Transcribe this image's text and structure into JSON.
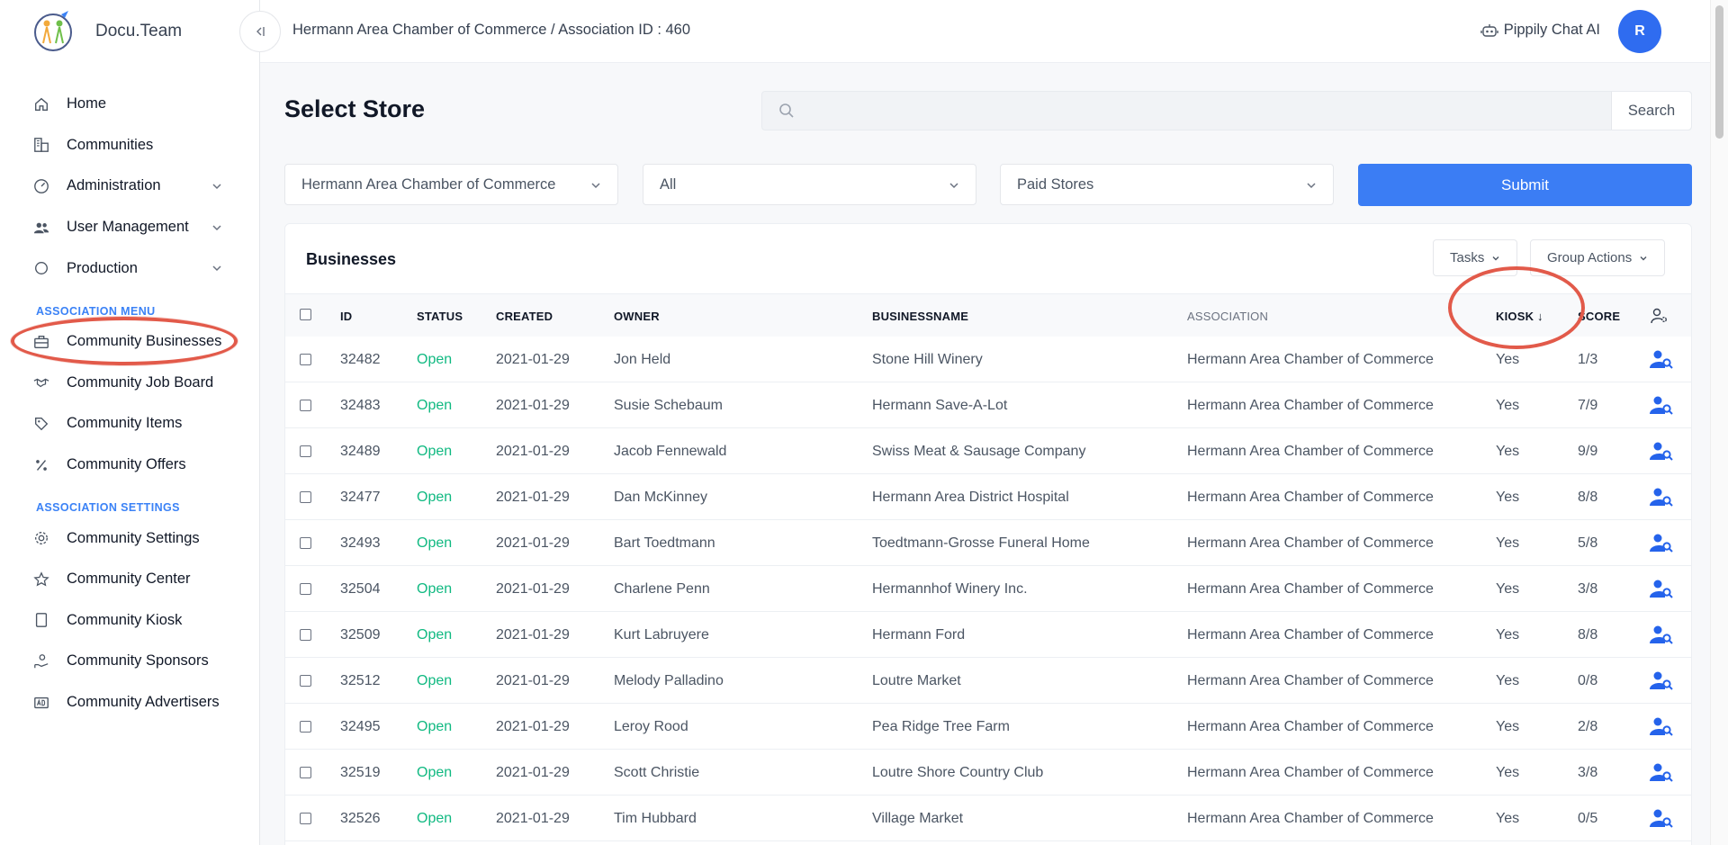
{
  "brand": {
    "name": "Docu.Team"
  },
  "sidebar": {
    "items": [
      {
        "label": "Home",
        "icon": "home-icon"
      },
      {
        "label": "Communities",
        "icon": "buildings-icon"
      },
      {
        "label": "Administration",
        "icon": "gauge-icon"
      },
      {
        "label": "User Management",
        "icon": "users-icon"
      },
      {
        "label": "Production",
        "icon": "circle-icon"
      }
    ],
    "section_association_menu": "ASSOCIATION MENU",
    "association_menu": [
      {
        "label": "Community Businesses",
        "icon": "briefcase-icon"
      },
      {
        "label": "Community Job Board",
        "icon": "handshake-icon"
      },
      {
        "label": "Community Items",
        "icon": "tag-icon"
      },
      {
        "label": "Community Offers",
        "icon": "percent-icon"
      }
    ],
    "section_association_settings": "ASSOCIATION SETTINGS",
    "association_settings": [
      {
        "label": "Community Settings",
        "icon": "gear-icon"
      },
      {
        "label": "Community Center",
        "icon": "star-icon"
      },
      {
        "label": "Community Kiosk",
        "icon": "tablet-icon"
      },
      {
        "label": "Community Sponsors",
        "icon": "hand-coin-icon"
      },
      {
        "label": "Community Advertisers",
        "icon": "ad-icon"
      }
    ]
  },
  "topbar": {
    "breadcrumb": "Hermann Area Chamber of Commerce / Association ID : 460",
    "chat_label": "Pippily Chat AI",
    "avatar_initial": "R"
  },
  "main": {
    "title": "Select Store",
    "search_placeholder": "",
    "search_button": "Search",
    "filters": {
      "association": "Hermann Area Chamber of Commerce",
      "category": "All",
      "store_type": "Paid Stores"
    },
    "submit_label": "Submit"
  },
  "businesses": {
    "title": "Businesses",
    "tasks_label": "Tasks",
    "group_actions_label": "Group Actions",
    "columns": {
      "id": "ID",
      "status": "STATUS",
      "created": "CREATED",
      "owner": "OWNER",
      "businessname": "BUSINESSNAME",
      "association": "ASSOCIATION",
      "kiosk": "KIOSK ↓",
      "score": "SCORE"
    },
    "rows": [
      {
        "id": "32482",
        "status": "Open",
        "created": "2021-01-29",
        "owner": "Jon Held",
        "business": "Stone Hill Winery",
        "association": "Hermann Area Chamber of Commerce",
        "kiosk": "Yes",
        "score": "1/3"
      },
      {
        "id": "32483",
        "status": "Open",
        "created": "2021-01-29",
        "owner": "Susie Schebaum",
        "business": "Hermann Save-A-Lot",
        "association": "Hermann Area Chamber of Commerce",
        "kiosk": "Yes",
        "score": "7/9"
      },
      {
        "id": "32489",
        "status": "Open",
        "created": "2021-01-29",
        "owner": "Jacob Fennewald",
        "business": "Swiss Meat & Sausage Company",
        "association": "Hermann Area Chamber of Commerce",
        "kiosk": "Yes",
        "score": "9/9"
      },
      {
        "id": "32477",
        "status": "Open",
        "created": "2021-01-29",
        "owner": "Dan McKinney",
        "business": "Hermann Area District Hospital",
        "association": "Hermann Area Chamber of Commerce",
        "kiosk": "Yes",
        "score": "8/8"
      },
      {
        "id": "32493",
        "status": "Open",
        "created": "2021-01-29",
        "owner": "Bart Toedtmann",
        "business": "Toedtmann-Grosse Funeral Home",
        "association": "Hermann Area Chamber of Commerce",
        "kiosk": "Yes",
        "score": "5/8"
      },
      {
        "id": "32504",
        "status": "Open",
        "created": "2021-01-29",
        "owner": "Charlene Penn",
        "business": "Hermannhof Winery Inc.",
        "association": "Hermann Area Chamber of Commerce",
        "kiosk": "Yes",
        "score": "3/8"
      },
      {
        "id": "32509",
        "status": "Open",
        "created": "2021-01-29",
        "owner": "Kurt Labruyere",
        "business": "Hermann Ford",
        "association": "Hermann Area Chamber of Commerce",
        "kiosk": "Yes",
        "score": "8/8"
      },
      {
        "id": "32512",
        "status": "Open",
        "created": "2021-01-29",
        "owner": "Melody Palladino",
        "business": "Loutre Market",
        "association": "Hermann Area Chamber of Commerce",
        "kiosk": "Yes",
        "score": "0/8"
      },
      {
        "id": "32495",
        "status": "Open",
        "created": "2021-01-29",
        "owner": "Leroy Rood",
        "business": "Pea Ridge Tree Farm",
        "association": "Hermann Area Chamber of Commerce",
        "kiosk": "Yes",
        "score": "2/8"
      },
      {
        "id": "32519",
        "status": "Open",
        "created": "2021-01-29",
        "owner": "Scott Christie",
        "business": "Loutre Shore Country Club",
        "association": "Hermann Area Chamber of Commerce",
        "kiosk": "Yes",
        "score": "3/8"
      },
      {
        "id": "32526",
        "status": "Open",
        "created": "2021-01-29",
        "owner": "Tim Hubbard",
        "business": "Village Market",
        "association": "Hermann Area Chamber of Commerce",
        "kiosk": "Yes",
        "score": "0/5"
      }
    ]
  },
  "colors": {
    "accent": "#3b7df4",
    "status_open": "#10b981",
    "annotation": "#e25a4a"
  }
}
